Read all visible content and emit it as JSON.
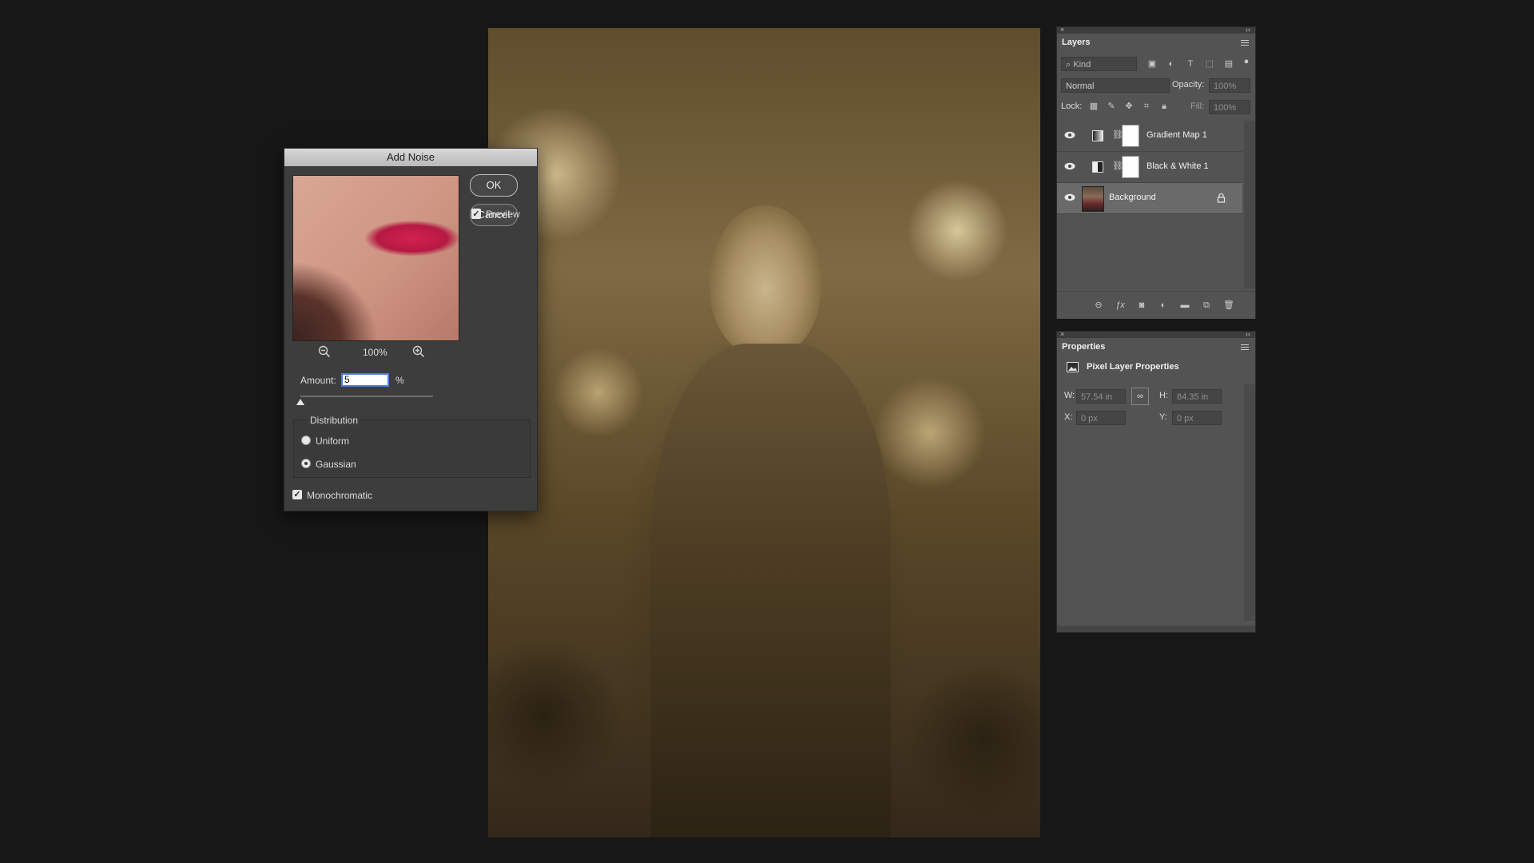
{
  "dialog": {
    "title": "Add Noise",
    "ok_label": "OK",
    "cancel_label": "Cancel",
    "preview_label": "Preview",
    "preview_checked": true,
    "zoom_level": "100%",
    "amount_label": "Amount:",
    "amount_value": "5",
    "amount_unit": "%",
    "distribution_label": "Distribution",
    "uniform_label": "Uniform",
    "gaussian_label": "Gaussian",
    "selected_distribution": "Gaussian",
    "monochromatic_label": "Monochromatic",
    "monochromatic_checked": true
  },
  "layers_panel": {
    "title": "Layers",
    "filter_kind": "Kind",
    "blend_mode": "Normal",
    "opacity_label": "Opacity:",
    "opacity_value": "100%",
    "lock_label": "Lock:",
    "fill_label": "Fill:",
    "fill_value": "100%",
    "layers": [
      {
        "name": "Gradient Map 1",
        "type": "adjustment",
        "visible": true
      },
      {
        "name": "Black & White 1",
        "type": "adjustment",
        "visible": true
      },
      {
        "name": "Background",
        "type": "pixel",
        "visible": true,
        "locked": true,
        "selected": true
      }
    ]
  },
  "properties_panel": {
    "title": "Properties",
    "section_title": "Pixel Layer Properties",
    "w_label": "W:",
    "w_value": "57.54 in",
    "h_label": "H:",
    "h_value": "84.35 in",
    "x_label": "X:",
    "x_value": "0 px",
    "y_label": "Y:",
    "y_value": "0 px"
  },
  "icons": {
    "close": "close-icon",
    "collapse": "double-chevron-icon",
    "menu": "panel-menu-icon",
    "eye": "eye-icon",
    "lock": "lock-icon",
    "link": "link-icon"
  },
  "colors": {
    "app_background": "#171717",
    "panel_background": "#535353",
    "dialog_background": "#3d3d3d",
    "focus_blue": "#4c7fd6"
  }
}
